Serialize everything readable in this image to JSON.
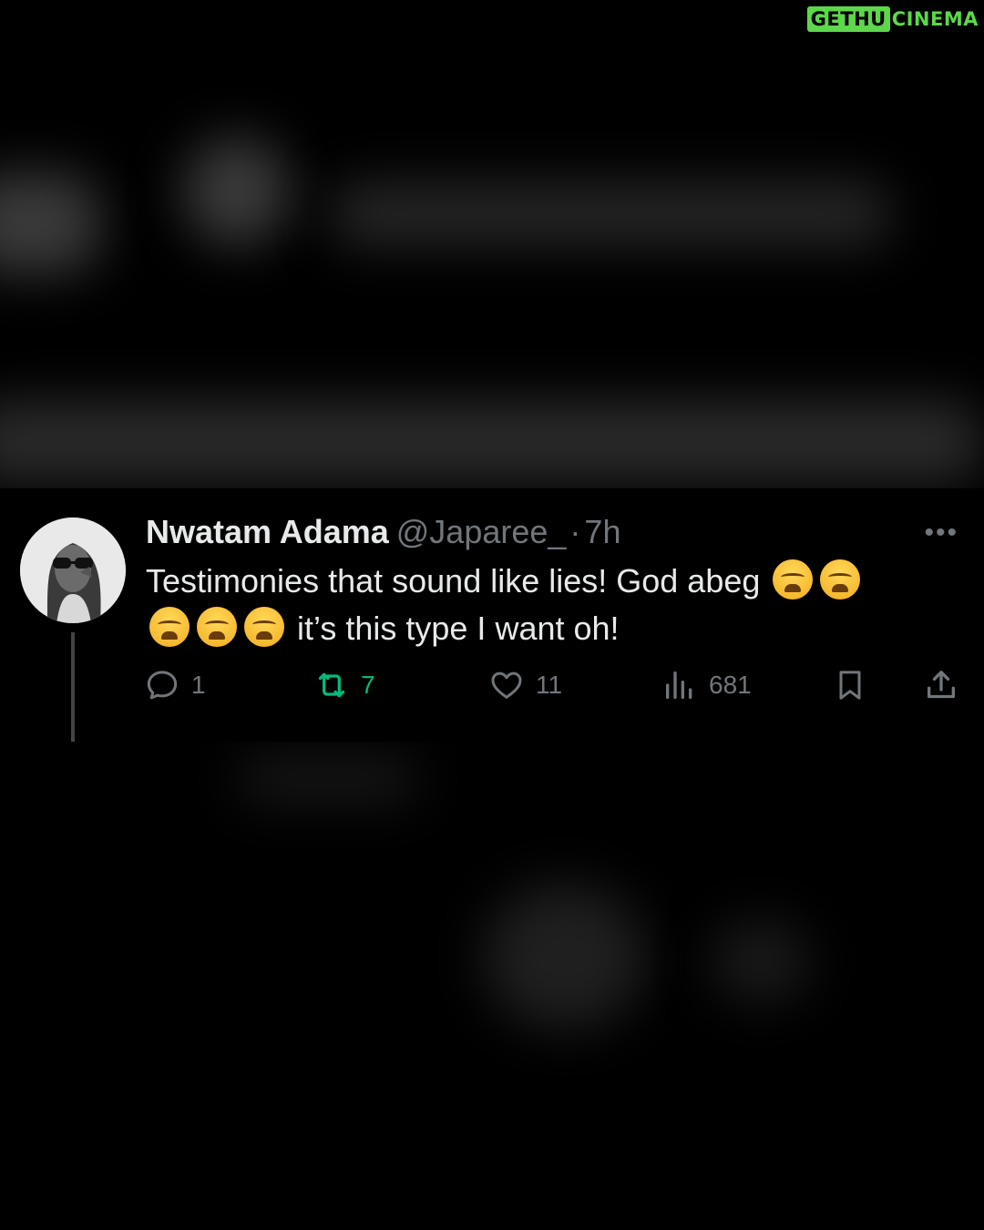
{
  "watermark": {
    "box_text": "GETHU",
    "text": "CINEMA"
  },
  "tweet": {
    "display_name": "Nwatam Adama",
    "handle": "@Japaree_",
    "separator": "·",
    "time": "7h",
    "more_label": "•••",
    "text_line1": "Testimonies that sound like lies! God abeg",
    "text_line2": "it’s this type I want oh!",
    "emoji": "weary-face"
  },
  "actions": {
    "replies": "1",
    "retweets": "7",
    "likes": "11",
    "views": "681"
  },
  "colors": {
    "background": "#000000",
    "text": "#e7e9ea",
    "muted": "#71767b",
    "retweet_active": "#00ba7c",
    "watermark": "#5cd84a"
  }
}
